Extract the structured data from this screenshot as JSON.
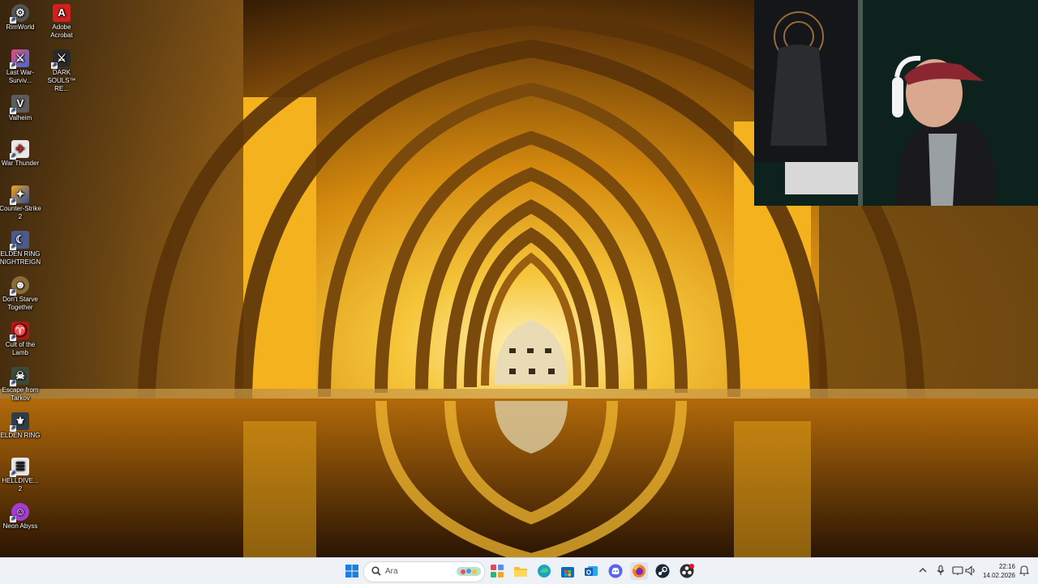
{
  "desktop": {
    "icons": [
      {
        "label": "RimWorld",
        "icon": "rimworld-icon",
        "color": "#444"
      },
      {
        "label": "Adobe Acrobat",
        "icon": "acrobat-icon",
        "color": "#d21f1f"
      },
      {
        "label": "Last War-Surviv...",
        "icon": "last-war-icon",
        "color": "#3a6fd6"
      },
      {
        "label": "DARK SOULS™ RE...",
        "icon": "dark-souls-icon",
        "color": "#2a2a2a"
      },
      {
        "label": "Valheim",
        "icon": "valheim-icon",
        "color": "#5c5c5c"
      },
      {
        "label": "War Thunder",
        "icon": "war-thunder-icon",
        "color": "#d9d9d9"
      },
      {
        "label": "Counter-Strike 2",
        "icon": "counter-strike-icon",
        "color": "#2b4fa8"
      },
      {
        "label": "ELDEN RING NIGHTREIGN",
        "icon": "nightreign-icon",
        "color": "#4a5a8a"
      },
      {
        "label": "Don't Starve Together",
        "icon": "dont-starve-icon",
        "color": "#8a6b3a"
      },
      {
        "label": "Cult of the Lamb",
        "icon": "cult-of-the-lamb-icon",
        "color": "#b01818"
      },
      {
        "label": "Escape from Tarkov",
        "icon": "tarkov-icon",
        "color": "#3d4a3a"
      },
      {
        "label": "ELDEN RING",
        "icon": "elden-ring-icon",
        "color": "#2f3f4a"
      },
      {
        "label": "HELLDIVE... 2",
        "icon": "helldivers-icon",
        "color": "#e8e8e8"
      },
      {
        "label": "Neon Abyss",
        "icon": "neon-abyss-icon",
        "color": "#a43bd6"
      }
    ]
  },
  "taskbar": {
    "search_placeholder": "Ara",
    "apps": [
      {
        "icon": "windows-start-icon",
        "color": "#1a7fe0"
      },
      {
        "icon": "widgets-icon",
        "color": "#5b8def"
      },
      {
        "icon": "file-explorer-icon",
        "color": "#f5c331"
      },
      {
        "icon": "edge-icon",
        "color": "#1fa0c8"
      },
      {
        "icon": "microsoft-store-icon",
        "color": "#0f6cbd"
      },
      {
        "icon": "outlook-icon",
        "color": "#1d6fcf"
      },
      {
        "icon": "discord-icon",
        "color": "#5865f2"
      },
      {
        "icon": "firefox-icon",
        "color": "#ff7a1a"
      },
      {
        "icon": "steam-icon",
        "color": "#1b2838"
      },
      {
        "icon": "obs-icon",
        "color": "#302e31"
      }
    ],
    "clock": {
      "time": "22:16",
      "date": "14.02.2026"
    }
  }
}
